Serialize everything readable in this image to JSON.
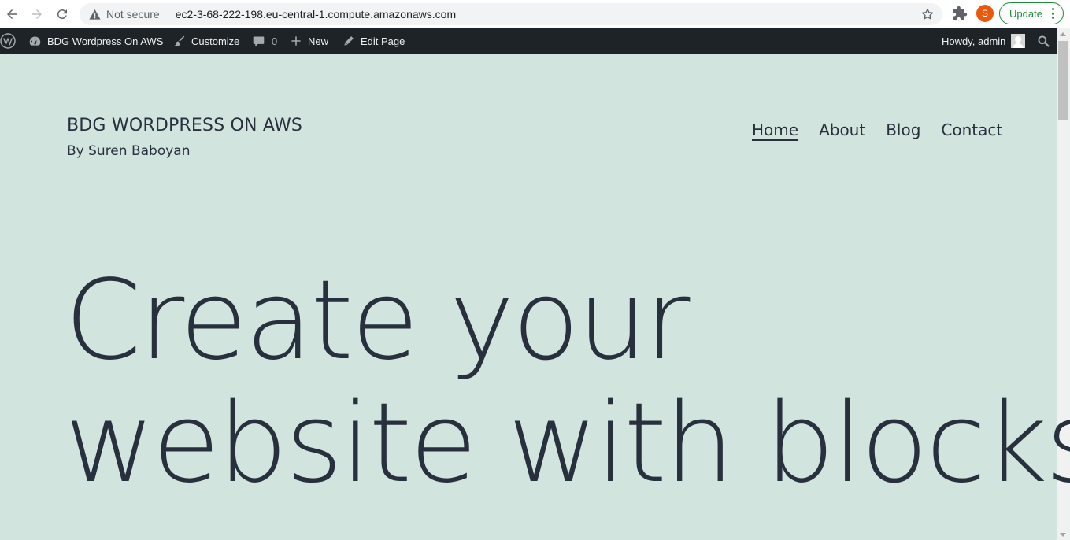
{
  "browser": {
    "security_label": "Not secure",
    "url": "ec2-3-68-222-198.eu-central-1.compute.amazonaws.com",
    "profile_initial": "S",
    "update_label": "Update",
    "icons": [
      "back-arrow-icon",
      "forward-arrow-icon",
      "reload-icon",
      "warning-icon",
      "star-icon",
      "puzzle-icon",
      "kebab-menu-icon"
    ]
  },
  "adminbar": {
    "site_name": "BDG Wordpress On AWS",
    "customize": "Customize",
    "comments_count": "0",
    "new": "New",
    "edit_page": "Edit Page",
    "howdy": "Howdy, admin",
    "bg_color": "#1d2327"
  },
  "site": {
    "title": "BDG WORDPRESS ON AWS",
    "description": "By Suren Baboyan",
    "menu": [
      "Home",
      "About",
      "Blog",
      "Contact"
    ],
    "current_menu": "Home",
    "bg_color": "#d1e4dd",
    "text_color": "#28303d"
  },
  "hero": {
    "line1": "Create your",
    "line2": "website with blocks"
  }
}
